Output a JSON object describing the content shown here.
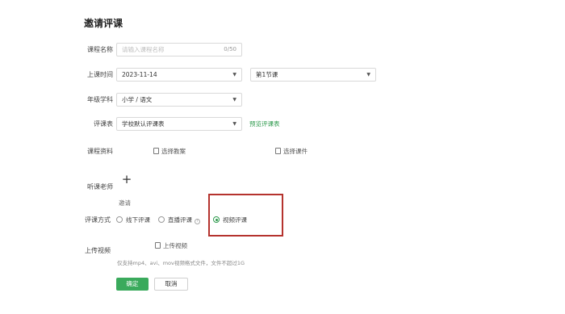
{
  "page": {
    "title": "邀请评课"
  },
  "form": {
    "course_name": {
      "label": "课程名称",
      "placeholder": "请输入课程名称",
      "counter": "0/50"
    },
    "class_time": {
      "label": "上课时间",
      "date_value": "2023-11-14",
      "period_value": "第1节课"
    },
    "grade_subject": {
      "label": "年级学科",
      "value": "小学 / 语文"
    },
    "evaluation_form": {
      "label": "评课表",
      "value": "学校默认评课表",
      "preview_link": "预览评课表"
    },
    "course_materials": {
      "label": "课程资料",
      "select_lesson_plan": "选择教案",
      "select_courseware": "选择课件"
    },
    "teacher": {
      "label": "听课老师",
      "add_symbol": "+",
      "invite_label": "邀请"
    },
    "evaluation_method": {
      "label": "评课方式",
      "options": [
        {
          "label": "线下评课",
          "selected": false
        },
        {
          "label": "直播评课",
          "selected": false,
          "help": "?"
        },
        {
          "label": "视频评课",
          "selected": true
        }
      ]
    },
    "upload_video": {
      "label": "上传视频",
      "button": "上传视频",
      "hint": "仅支持mp4、avi、mov视频格式文件，文件不超过1G"
    }
  },
  "actions": {
    "submit": "确定",
    "cancel": "取消"
  },
  "colors": {
    "accent": "#3aaa5c",
    "highlight": "#b5332e"
  }
}
